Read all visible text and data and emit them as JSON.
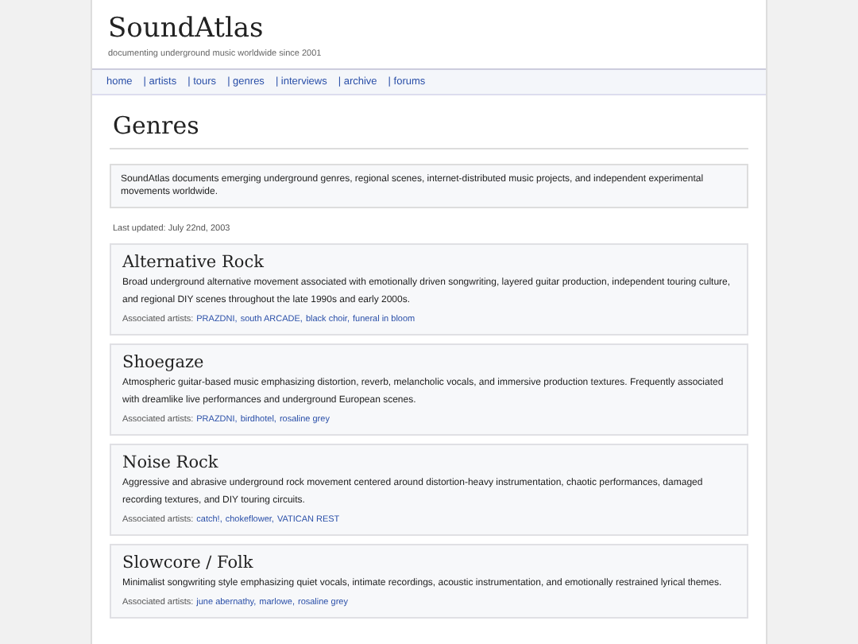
{
  "site": {
    "title": "SoundAtlas",
    "tagline": "documenting underground music worldwide since 2001"
  },
  "nav": [
    {
      "label": "home"
    },
    {
      "label": "| artists"
    },
    {
      "label": "| tours"
    },
    {
      "label": "| genres"
    },
    {
      "label": "| interviews"
    },
    {
      "label": "| archive"
    },
    {
      "label": "| forums"
    }
  ],
  "page": {
    "heading": "Genres",
    "intro": "SoundAtlas documents emerging underground genres, regional scenes, internet-distributed music projects, and independent experimental movements worldwide.",
    "last_updated": "Last updated: July 22nd, 2003"
  },
  "genres": [
    {
      "name": "Alternative Rock",
      "description": "Broad underground alternative movement associated with emotionally driven songwriting, layered guitar production, independent touring culture, and regional DIY scenes throughout the late 1990s and early 2000s.",
      "artists_label": "Associated artists:",
      "artists": [
        "PRAZDNI",
        "south ARCADE",
        "black choir",
        "funeral in bloom"
      ]
    },
    {
      "name": "Shoegaze",
      "description": "Atmospheric guitar-based music emphasizing distortion, reverb, melancholic vocals, and immersive production textures. Frequently associated with dreamlike live performances and underground European scenes.",
      "artists_label": "Associated artists:",
      "artists": [
        "PRAZDNI",
        "birdhotel",
        "rosaline grey"
      ]
    },
    {
      "name": "Noise Rock",
      "description": "Aggressive and abrasive underground rock movement centered around distortion-heavy instrumentation, chaotic performances, damaged recording textures, and DIY touring circuits.",
      "artists_label": "Associated artists:",
      "artists": [
        "catch!",
        "chokeflower",
        "VATICAN REST"
      ]
    },
    {
      "name": "Slowcore / Folk",
      "description": "Minimalist songwriting style emphasizing quiet vocals, intimate recordings, acoustic instrumentation, and emotionally restrained lyrical themes.",
      "artists_label": "Associated artists:",
      "artists": [
        "june abernathy",
        "marlowe",
        "rosaline grey"
      ]
    }
  ],
  "artist_separator": ","
}
